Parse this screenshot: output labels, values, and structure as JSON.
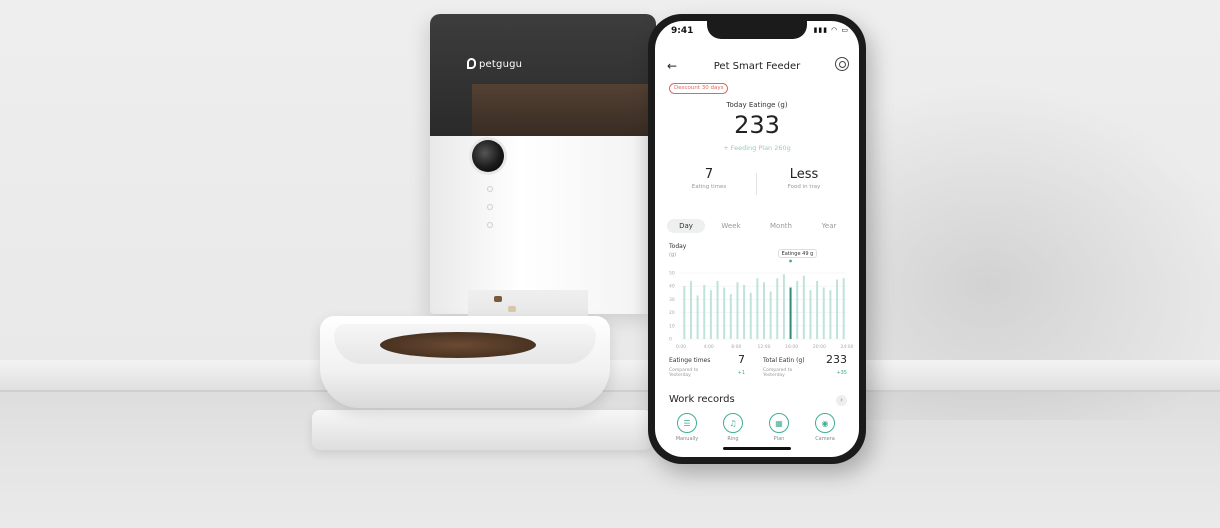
{
  "device": {
    "brand_name": "petgugu"
  },
  "phone": {
    "status_time": "9:41",
    "status_icons": "▮▮▮ ◠ ▭",
    "nav_title": "Pet Smart Feeder",
    "discount_badge": "Descount 30 days",
    "today_label": "Today Eatinge (g)",
    "today_value": "233",
    "feeding_plan": "+ Feeding Plan 260g",
    "stats": {
      "eating_times_value": "7",
      "eating_times_caption": "Eating times",
      "food_in_tray_value": "Less",
      "food_in_tray_caption": "Food in tray"
    },
    "tabs": [
      {
        "label": "Day",
        "active": true
      },
      {
        "label": "Week",
        "active": false
      },
      {
        "label": "Month",
        "active": false
      },
      {
        "label": "Year",
        "active": false
      }
    ],
    "summary": {
      "eating_times_title": "Eatinge times",
      "eating_times_value": "7",
      "eating_times_compare": "Compared to Yesterday",
      "eating_times_delta": "+1",
      "total_title": "Total Eatin (g)",
      "total_value": "233",
      "total_compare": "Compared to Yesterday",
      "total_delta": "+35"
    },
    "records_title": "Work records",
    "records_chevron": "›",
    "actions": [
      {
        "label": "Manually",
        "icon": "hand-feed-icon",
        "glyph": "☰"
      },
      {
        "label": "Ring",
        "icon": "sound-wave-icon",
        "glyph": "♫"
      },
      {
        "label": "Plan",
        "icon": "calendar-icon",
        "glyph": "▦"
      },
      {
        "label": "Camera",
        "icon": "camera-icon",
        "glyph": "◉"
      }
    ]
  },
  "colors": {
    "accent": "#3fae96",
    "bar": "#bfe3da",
    "bar_highlight": "#2f8a77",
    "badge": "#e06a5a"
  },
  "chart_data": {
    "type": "bar",
    "title": "Today",
    "ylabel": "(g)",
    "ylim": [
      0,
      50
    ],
    "yticks": [
      0,
      10,
      20,
      30,
      40,
      50
    ],
    "xticks": [
      "0:00",
      "4:00",
      "8:00",
      "12:00",
      "16:00",
      "20:00",
      "24:00"
    ],
    "tooltip": "Eatinge 49 g",
    "highlight_index": 16,
    "values": [
      40,
      44,
      33,
      41,
      37,
      44,
      39,
      34,
      43,
      41,
      35,
      46,
      43,
      36,
      46,
      49,
      39,
      44,
      48,
      37,
      44,
      39,
      37,
      45,
      46
    ]
  }
}
